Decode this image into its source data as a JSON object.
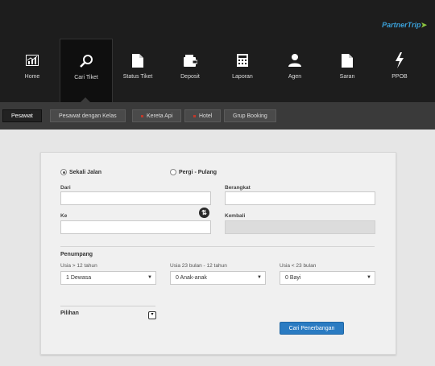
{
  "brand": {
    "logo_text": "PartnerTrip",
    "colors": {
      "topbar": "#1d1d1d",
      "subbar": "#3a3a3a",
      "accent": "#2a7bc2"
    }
  },
  "nav": {
    "items": [
      {
        "label": "Home",
        "icon": "chart-icon"
      },
      {
        "label": "Cari Tiket",
        "icon": "search-icon",
        "active": true
      },
      {
        "label": "Status Tiket",
        "icon": "document-icon"
      },
      {
        "label": "Deposit",
        "icon": "wallet-icon"
      },
      {
        "label": "Laporan",
        "icon": "calculator-icon"
      },
      {
        "label": "Agen",
        "icon": "user-icon"
      },
      {
        "label": "Saran",
        "icon": "document-icon"
      },
      {
        "label": "PPOB",
        "icon": "lightning-icon"
      }
    ]
  },
  "subnav": {
    "tabs": [
      {
        "label": "Pesawat",
        "active": true
      },
      {
        "label": "Pesawat dengan Kelas"
      },
      {
        "label": "Kereta Api",
        "dot": true
      },
      {
        "label": "Hotel",
        "dot": true
      },
      {
        "label": "Grup Booking"
      }
    ]
  },
  "form": {
    "trip_type": {
      "one_way": "Sekali Jalan",
      "round_trip": "Pergi - Pulang",
      "selected": "one_way"
    },
    "from_label": "Dari",
    "to_label": "Ke",
    "depart_label": "Berangkat",
    "return_label": "Kembali",
    "from_value": "",
    "to_value": "",
    "depart_value": "",
    "return_value": "",
    "passengers": {
      "title": "Penumpang",
      "adult_label": "Usia > 12 tahun",
      "adult_value": "1 Dewasa",
      "child_label": "Usia 23 bulan - 12 tahun",
      "child_value": "0 Anak-anak",
      "infant_label": "Usia < 23 bulan",
      "infant_value": "0 Bayi"
    },
    "options_label": "Pilihan",
    "submit_label": "Cari Penerbangan"
  }
}
